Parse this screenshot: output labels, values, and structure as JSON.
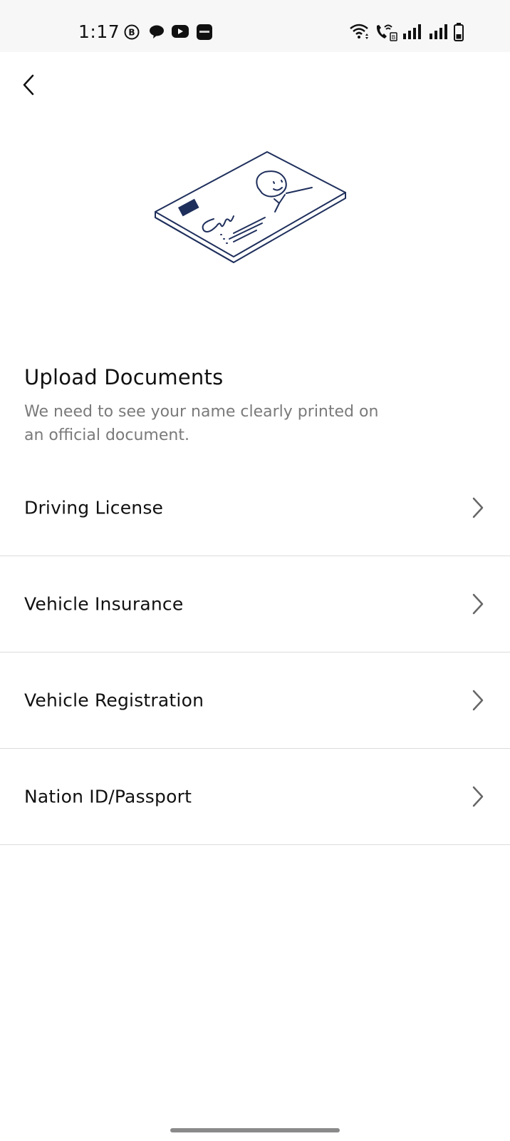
{
  "status_bar": {
    "time": "1:17",
    "left_icons": [
      "b-circle-icon",
      "chat-bubble-icon",
      "youtube-icon",
      "app-badge-icon"
    ],
    "right_icons": [
      "wifi-icon",
      "wifi-call-icon",
      "signal-icon",
      "signal-icon",
      "battery-icon"
    ]
  },
  "header": {
    "back_icon": "chevron-left-icon"
  },
  "illustration": {
    "icon": "id-card-illustration",
    "accent_color": "#1f2f5c"
  },
  "content": {
    "title": "Upload Documents",
    "subtitle": "We need to see your name clearly printed on an official document."
  },
  "documents": [
    {
      "label": "Driving License",
      "icon": "chevron-right-icon"
    },
    {
      "label": "Vehicle Insurance",
      "icon": "chevron-right-icon"
    },
    {
      "label": "Vehicle Registration",
      "icon": "chevron-right-icon"
    },
    {
      "label": "Nation ID/Passport",
      "icon": "chevron-right-icon"
    }
  ]
}
